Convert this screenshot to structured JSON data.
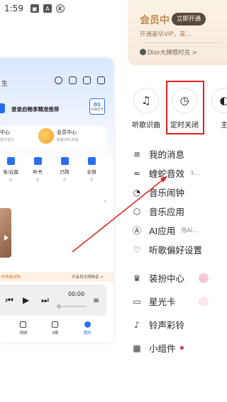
{
  "status_bar": {
    "time": "1:59",
    "icons": [
      {
        "name": "image-icon",
        "glyph": "▣"
      },
      {
        "name": "a-icon",
        "glyph": "A"
      },
      {
        "name": "k-circle-icon",
        "glyph": "K"
      }
    ]
  },
  "preview": {
    "header_text": "生",
    "login_prompt": "登录后畅享精准推荐",
    "calendar_day": "01",
    "calendar_label": "今日打卡",
    "card_left_title": "中心",
    "card_left_sub": "豪华音乐",
    "card_right_title": "会员中心",
    "card_right_sub": "新客VIP1折起",
    "grid": [
      {
        "label": "坐/云盘",
        "count": "0"
      },
      {
        "label": "听书",
        "count": "0"
      },
      {
        "label": "已购",
        "count": "0"
      },
      {
        "label": "全部",
        "count": "0"
      }
    ],
    "promo_left": "时先收试听",
    "promo_right": "开会员无限畅享 >",
    "player_time": "00:00",
    "nav": [
      "视频",
      "K歌",
      "我的"
    ]
  },
  "drawer": {
    "vip": {
      "title": "会员中",
      "open_button": "立即开通",
      "subtitle": "开通豪华VIP，享...",
      "brand_link": "Dior大牌限时兑 >"
    },
    "quick_actions": [
      {
        "label": "听歌识曲",
        "icon": "music-recognition-icon",
        "glyph": "♫"
      },
      {
        "label": "定时关闭",
        "icon": "clock-icon",
        "glyph": "◷"
      },
      {
        "label": "主",
        "icon": "theme-icon",
        "glyph": "◐"
      }
    ],
    "menu": [
      {
        "label": "我的消息",
        "icon": "message-icon",
        "glyph": "≡",
        "sub": ""
      },
      {
        "label": "蝰蛇音效",
        "icon": "sound-effect-icon",
        "glyph": "≈",
        "sub": "3..."
      },
      {
        "label": "音乐闹钟",
        "icon": "alarm-icon",
        "glyph": "◔",
        "sub": ""
      },
      {
        "label": "音乐应用",
        "icon": "app-cube-icon",
        "glyph": "⬡",
        "sub": ""
      },
      {
        "label": "AI应用",
        "icon": "ai-icon",
        "glyph": "Ⓐ",
        "sub": "用AI..."
      },
      {
        "label": "听歌偏好设置",
        "icon": "preference-icon",
        "glyph": "♡",
        "sub": ""
      }
    ],
    "menu2": [
      {
        "label": "装扮中心",
        "icon": "dress-up-icon",
        "glyph": "♛"
      },
      {
        "label": "星光卡",
        "icon": "star-card-icon",
        "glyph": "▭"
      },
      {
        "label": "铃声彩铃",
        "icon": "bell-icon",
        "glyph": "♪"
      },
      {
        "label": "小组件",
        "icon": "widget-icon",
        "glyph": "▦"
      }
    ]
  },
  "colors": {
    "accent_blue": "#2a6ef0",
    "highlight_red": "#e02020",
    "vip_gold": "#c08a4a"
  }
}
